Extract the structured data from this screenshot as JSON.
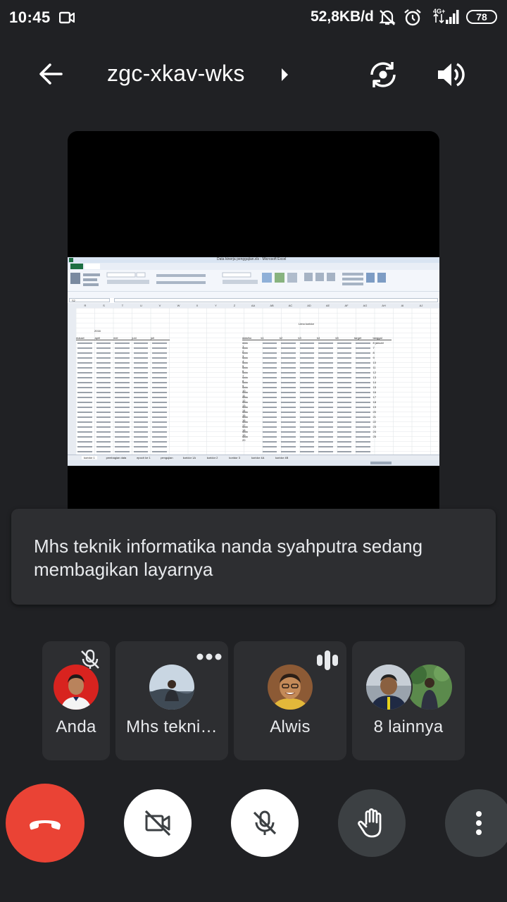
{
  "status_bar": {
    "time": "10:45",
    "net_speed": "52,8KB/d",
    "battery": "78",
    "icons": [
      "video-record-icon",
      "mute-notification-icon",
      "alarm-icon",
      "signal-4g-icon"
    ]
  },
  "header": {
    "meeting_code": "zgc-xkav-wks",
    "icons": [
      "back-arrow-icon",
      "chevron-right-icon",
      "switch-camera-icon",
      "speaker-icon"
    ]
  },
  "shared_screen": {
    "window_title": "Data kinerja penggajian.xls - Microsoft Excel",
    "sheet_title": "Lima koridor",
    "cell_ref": "S2",
    "col_headers": [
      "R",
      "S",
      "T",
      "U",
      "V",
      "W",
      "X",
      "Y",
      "Z",
      "AA",
      "AB",
      "AC",
      "AD",
      "AE",
      "AF",
      "AG",
      "AH",
      "AI",
      "AJ"
    ],
    "year_label": "2016",
    "left_headers": [
      "mauwi",
      "april",
      "mei",
      "juni",
      "juli"
    ],
    "right_headers": [
      "data/ko",
      "k1",
      "k2",
      "k3",
      "k4",
      "k5",
      "target",
      "tanggal"
    ],
    "right_rows": [
      "data 1",
      "data 2",
      "data 3",
      "data 4",
      "data 5",
      "data 6",
      "data 7",
      "data 8",
      "data 9",
      "data 10",
      "data 11",
      "data 12",
      "data 13",
      "data 14",
      "data 15",
      "data 16",
      "data 17",
      "data 18",
      "data 19",
      "data 20"
    ],
    "tanggal_col": [
      "8 januari",
      "7",
      "8",
      "9",
      "10",
      "11",
      "12",
      "13",
      "14",
      "15",
      "16",
      "17",
      "18",
      "19",
      "20",
      "21",
      "22",
      "23",
      "24",
      "25"
    ],
    "sheet_tabs": [
      "koridor 1",
      "pembagian data",
      "epoch ke 1",
      "pengujian",
      "koridor 1A",
      "koridor 2",
      "koridor 3",
      "koridor 4A",
      "koridor 4B"
    ]
  },
  "toast": {
    "message": "Mhs teknik informatika nanda syahputra sedang membagikan layarnya"
  },
  "participants": [
    {
      "name": "Anda",
      "status_icon": "mic-off-icon"
    },
    {
      "name": "Mhs tekni…",
      "status_icon": "more-options-icon"
    },
    {
      "name": "Alwis",
      "status_icon": "speaking-icon"
    },
    {
      "name": "8 lainnya",
      "status_icon": ""
    }
  ],
  "controls": {
    "icons": [
      "end-call-icon",
      "camera-off-icon",
      "mic-off-icon",
      "raise-hand-icon",
      "more-vert-icon"
    ],
    "colors": {
      "end_call": "#ea4335",
      "active": "#ffffff",
      "inactive": "#3c4043"
    }
  }
}
